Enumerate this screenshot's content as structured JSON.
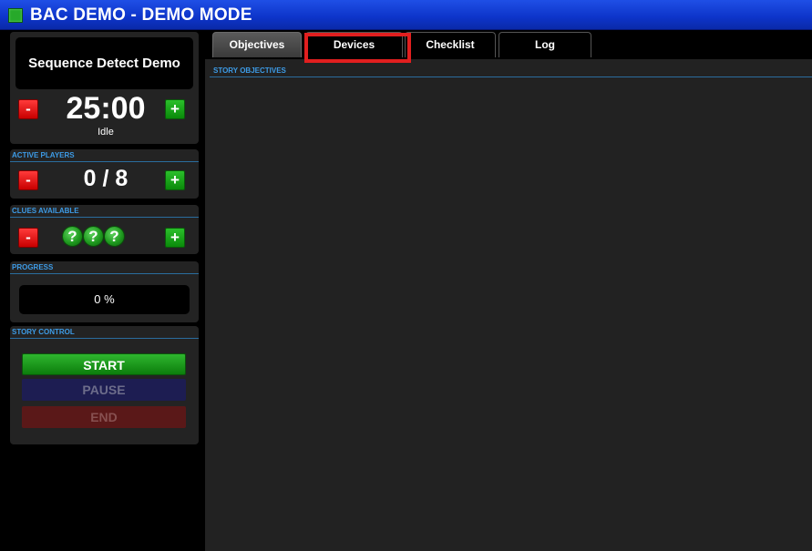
{
  "window": {
    "title": "BAC DEMO - DEMO MODE",
    "indicator_color": "#27a92a"
  },
  "story": {
    "name": "Sequence Detect Demo",
    "timer": "25:00",
    "status": "Idle"
  },
  "active_players": {
    "label": "ACTIVE PLAYERS",
    "value": "0 / 8",
    "minus_label": "-",
    "plus_label": "+"
  },
  "timer_controls": {
    "minus_label": "-",
    "plus_label": "+"
  },
  "clues": {
    "label": "CLUES AVAILABLE",
    "icons": [
      "?",
      "?",
      "?"
    ],
    "minus_label": "-",
    "plus_label": "+"
  },
  "progress": {
    "label": "PROGRESS",
    "value": "0 %"
  },
  "story_control": {
    "label": "STORY CONTROL",
    "start_label": "START",
    "pause_label": "PAUSE",
    "end_label": "END"
  },
  "tabs": [
    {
      "label": "Objectives",
      "active": true
    },
    {
      "label": "Devices",
      "active": false
    },
    {
      "label": "Checklist",
      "active": false
    },
    {
      "label": "Log",
      "active": false
    }
  ],
  "objectives": {
    "section_label": "STORY OBJECTIVES"
  },
  "colors": {
    "accent_blue": "#3d9be6",
    "title_bar": "#0d34c9",
    "highlight": "#e11f1f"
  }
}
